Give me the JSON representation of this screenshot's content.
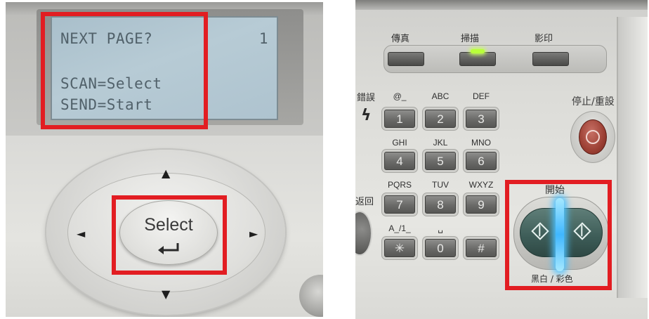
{
  "lcd": {
    "line1": "NEXT PAGE?",
    "page_number": "1",
    "line2": "SCAN=Select",
    "line3": "SEND=Start"
  },
  "left_panel": {
    "select_button_label": "Select",
    "arrows": {
      "up": "▲",
      "down": "▼",
      "left": "◄",
      "right": "►"
    },
    "highlight_color": "#e21d22"
  },
  "right_panel": {
    "mode_buttons": [
      "傳真",
      "掃描",
      "影印"
    ],
    "active_mode": "掃描",
    "led_color": "#b8ff3a",
    "error_label": "錯誤",
    "redial_label": "返回",
    "clear_symbol": "ϟ",
    "keypad": [
      {
        "letters": "@_",
        "digit": "1"
      },
      {
        "letters": "ABC",
        "digit": "2"
      },
      {
        "letters": "DEF",
        "digit": "3"
      },
      {
        "letters": "GHI",
        "digit": "4"
      },
      {
        "letters": "JKL",
        "digit": "5"
      },
      {
        "letters": "MNO",
        "digit": "6"
      },
      {
        "letters": "PQRS",
        "digit": "7"
      },
      {
        "letters": "TUV",
        "digit": "8"
      },
      {
        "letters": "WXYZ",
        "digit": "9"
      },
      {
        "letters": "A_/1_",
        "digit": "✳"
      },
      {
        "letters": "␣",
        "digit": "0"
      },
      {
        "letters": "",
        "digit": "#"
      }
    ],
    "stop_label": "停止/重設",
    "start_label": "開始",
    "start_sub_label": "黑白 / 彩色",
    "start_glow_color": "#3fb7ff"
  }
}
